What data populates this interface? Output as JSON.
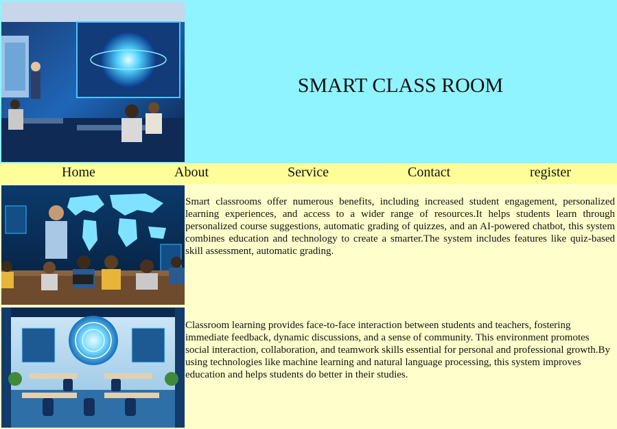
{
  "header": {
    "title": "SMART CLASS ROOM"
  },
  "nav": {
    "items": [
      {
        "label": "Home"
      },
      {
        "label": "About"
      },
      {
        "label": "Service"
      },
      {
        "label": "Contact"
      },
      {
        "label": "register"
      }
    ]
  },
  "sections": [
    {
      "text": "Smart classrooms offer numerous benefits, including increased student engagement, personalized learning experiences, and access to a wider range of resources.It helps students learn through personalized course suggestions, automatic grading of quizzes, and an AI-powered chatbot, this system combines education and technology to create a smarter.The system includes features like quiz-based skill assessment, automatic grading."
    },
    {
      "text": "Classroom learning provides face-to-face interaction between students and teachers, fostering immediate feedback, dynamic discussions, and a sense of community. This environment promotes social interaction, collaboration, and teamwork skills essential for personal and professional growth.By using technologies like machine learning and natural language processing, this system improves education and helps students do better in their studies."
    }
  ],
  "colors": {
    "header_bg": "#8ff4ff",
    "nav_bg": "#ffff99",
    "content_bg": "#ffffcc"
  }
}
